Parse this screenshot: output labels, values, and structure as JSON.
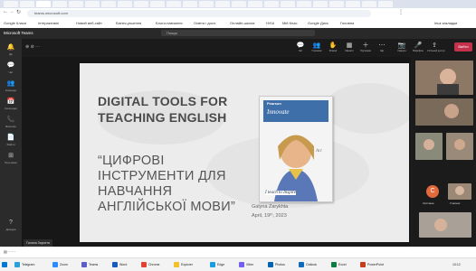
{
  "browser": {
    "address": "teams.microsoft.com",
    "bookmarks": [
      "Google Класи",
      "Інтерактивні",
      "Новий веб-сайт",
      "Бізнес-рішення",
      "Блоги-навчання",
      "Освіта і досл.",
      "Онлайн-школа",
      "НУШ",
      "Мій Клас",
      "Google Диск",
      "Головна",
      "Інші закладки"
    ]
  },
  "teams": {
    "app_name": "Microsoft Teams",
    "search_placeholder": "Пошук",
    "rail": [
      "Дії",
      "Чат",
      "Команди",
      "Календар",
      "Виклики",
      "Файли",
      "Програми",
      "Довідка"
    ],
    "toolbar": [
      "Чат",
      "Учасники",
      "Реакції",
      "Кімнати",
      "Програми",
      "Ще",
      "Камера",
      "Мікрофон",
      "Спільний доступ"
    ],
    "leave_label": "Вийти",
    "presenter_name": "Галина Зарихта"
  },
  "slide": {
    "title_en_line1": "DIGITAL TOOLS FOR",
    "title_en_line2": "TEACHING ENGLISH",
    "title_ua_line1": "“ЦИФРОВІ",
    "title_ua_line2": "ІНСТРУМЕНТИ ДЛЯ",
    "title_ua_line3": "НАВЧАННЯ",
    "title_ua_line4": "АНГЛІЙСЬКОЇ МОВИ”",
    "author": "Galyna Zarykhta",
    "date": "April, 19ᵗʰ, 2023",
    "photo_brand": "Pearson",
    "photo_word1": "Innovate",
    "photo_word2": "Act",
    "photo_tagline": "I teach to Inspire"
  },
  "participants": {
    "avatar_initial": "C",
    "label1": "Світлана",
    "label2": "Учасник"
  },
  "taskbar": {
    "items": [
      "Telegram",
      "Zoom",
      "Teams",
      "Word",
      "Chrome",
      "Explorer",
      "Edge",
      "Viber",
      "Photos",
      "Outlook",
      "Excel",
      "PowerPoint"
    ],
    "time": "10:12"
  },
  "colors": {
    "leave": "#c4314b",
    "slide_bg": "#ececec",
    "teams_bg": "#1f1f1f"
  }
}
